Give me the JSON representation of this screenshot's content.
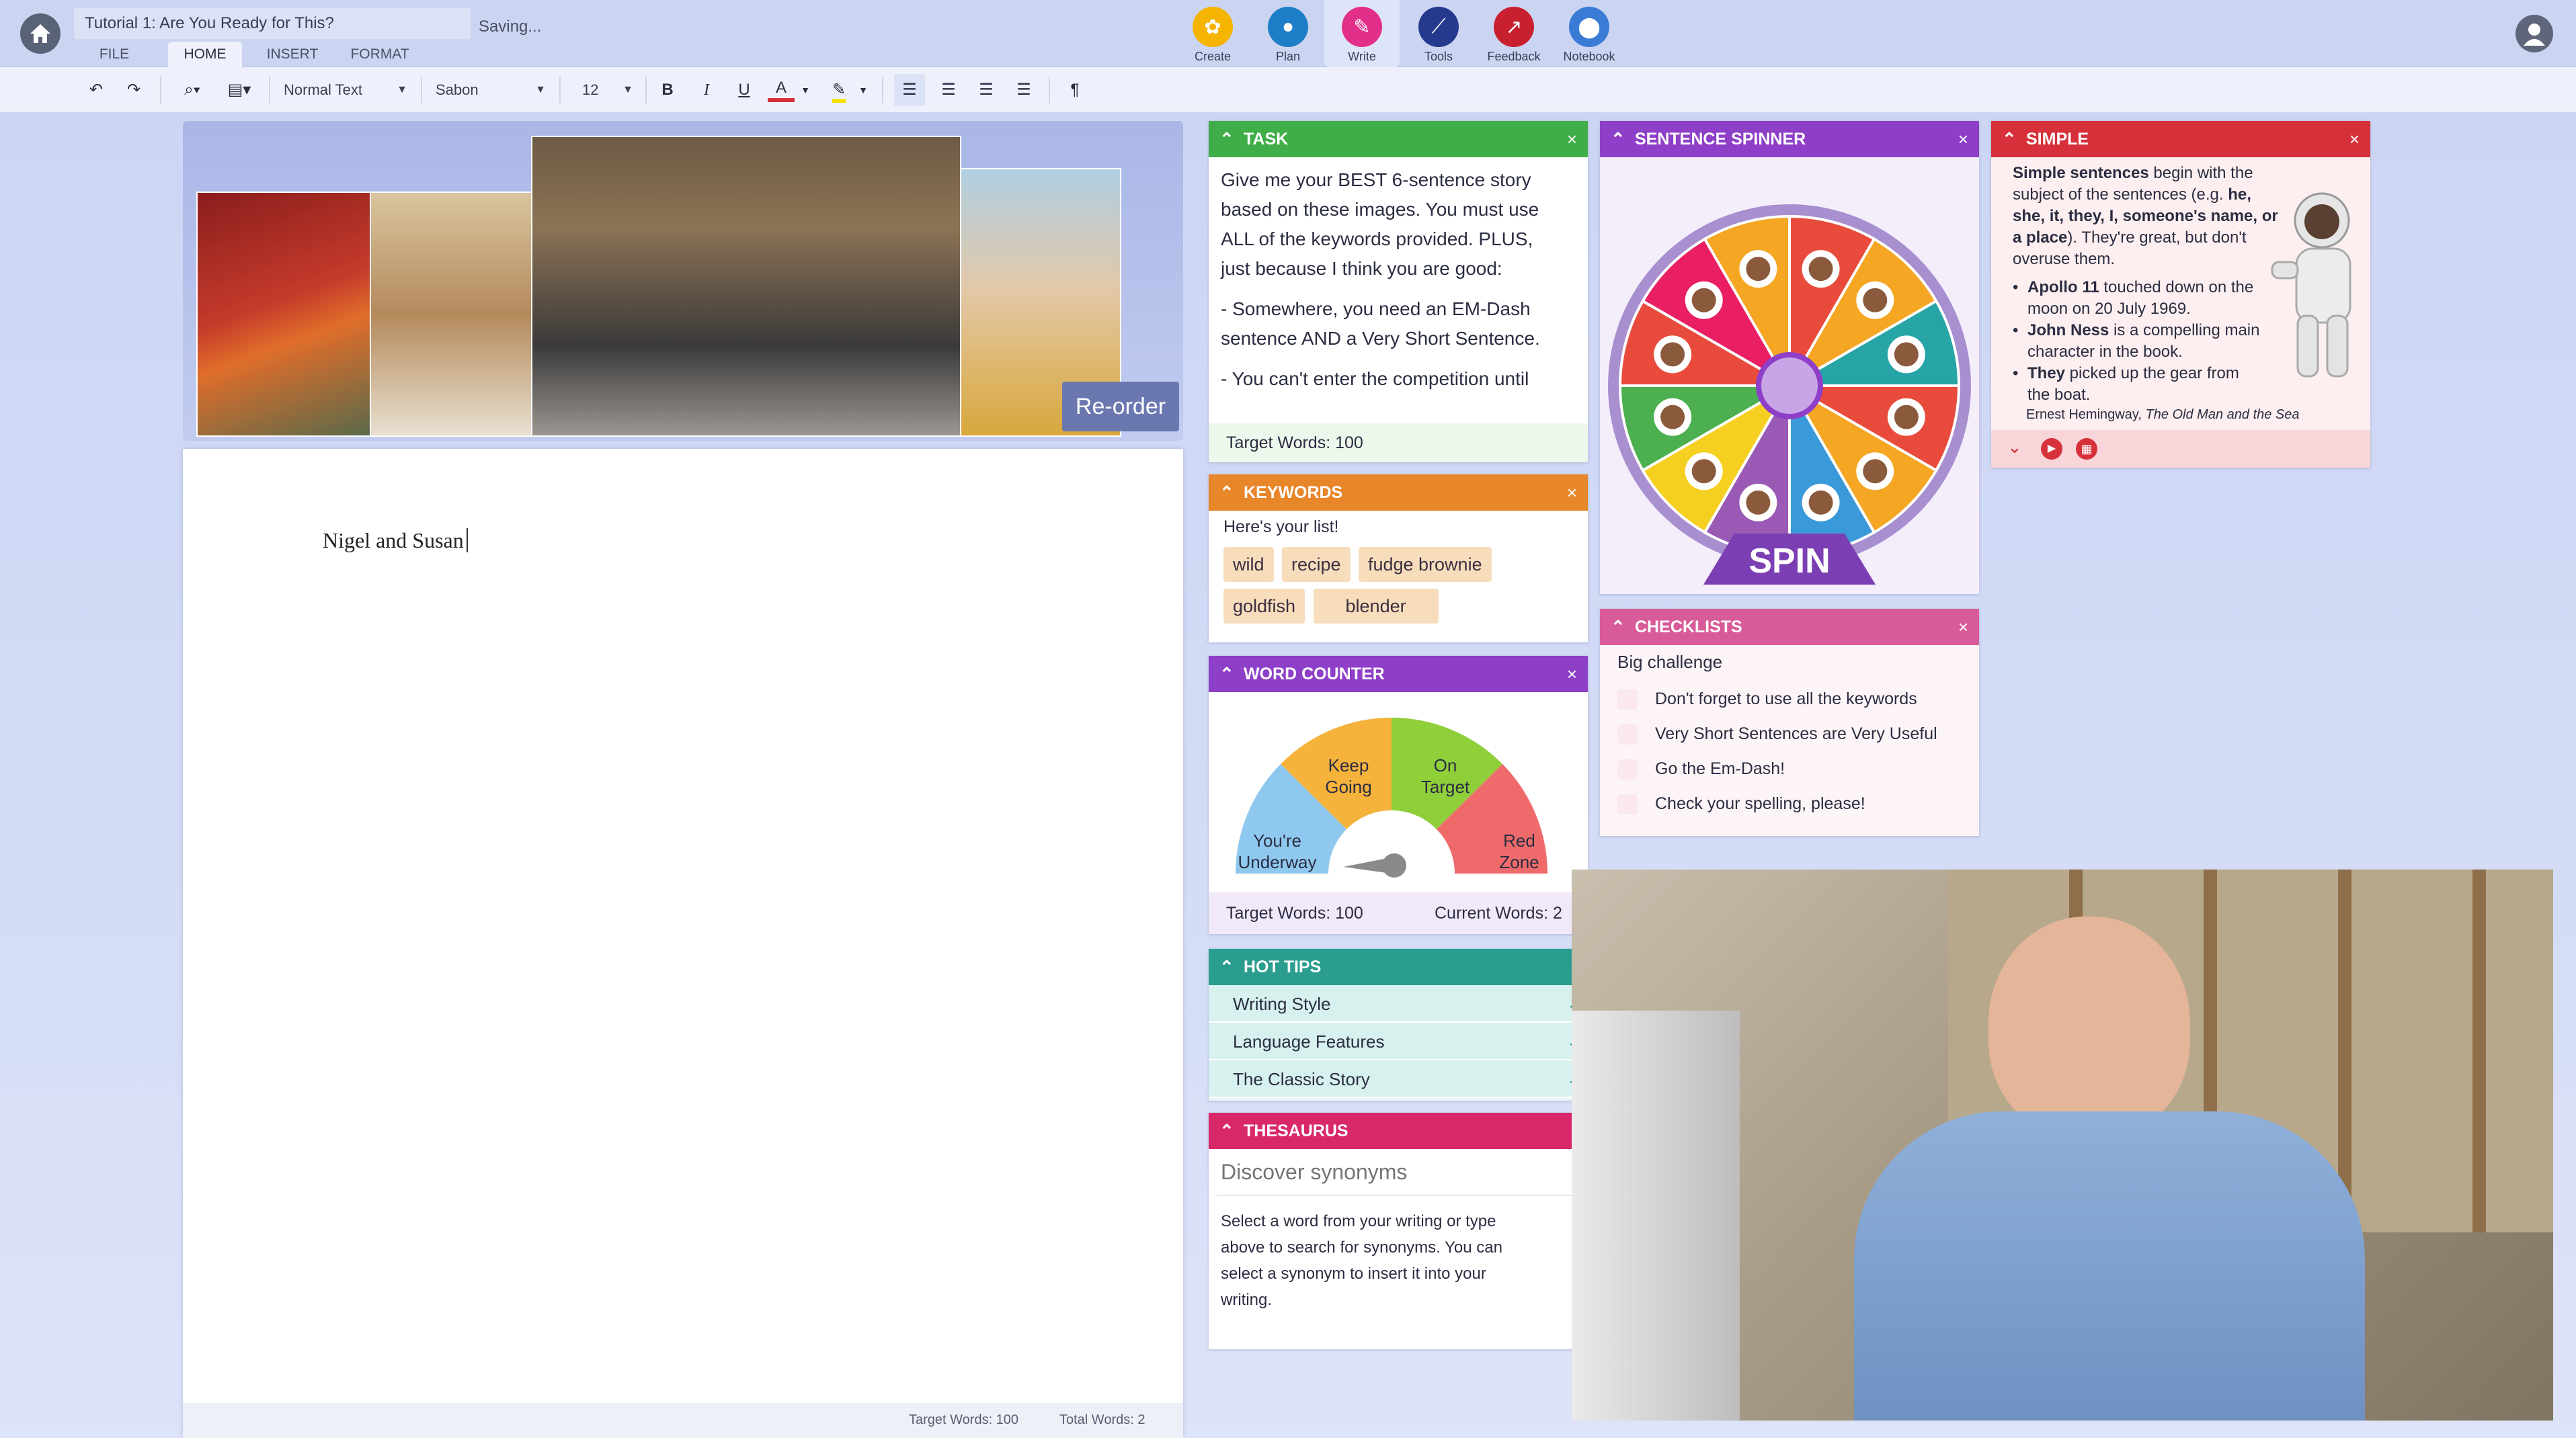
{
  "app": {
    "doc_title": "Tutorial 1: Are You Ready for This?",
    "saving": "Saving..."
  },
  "menu": [
    "FILE",
    "HOME",
    "INSERT",
    "FORMAT"
  ],
  "top_icons": [
    {
      "label": "Create",
      "icon": "create-icon",
      "color": "#f4b400"
    },
    {
      "label": "Plan",
      "icon": "plan-icon",
      "color": "#1d7dc6"
    },
    {
      "label": "Write",
      "icon": "write-icon",
      "color": "#e2308a"
    },
    {
      "label": "Tools",
      "icon": "tools-icon",
      "color": "#253a8f"
    },
    {
      "label": "Feedback",
      "icon": "feedback-icon",
      "color": "#c8202f"
    },
    {
      "label": "Notebook",
      "icon": "notebook-icon",
      "color": "#3a7bd5"
    }
  ],
  "toolbar": {
    "style": "Normal Text",
    "font": "Sabon",
    "size": "12",
    "bold": "B",
    "italic": "I",
    "underline": "U",
    "font_color": "A",
    "pilcrow": "¶"
  },
  "strip": {
    "reorder": "Re-order"
  },
  "document": {
    "text": "Nigel and Susan",
    "target": "Target Words: 100",
    "total": "Total Words: 2"
  },
  "task": {
    "title": "TASK",
    "lines": [
      "Give me your BEST 6-sentence story",
      "based on these images. You must use",
      "ALL of the keywords provided. PLUS,",
      "just because I think you are good:",
      "",
      "- Somewhere, you need an EM-Dash",
      "sentence AND a Very Short Sentence.",
      "",
      "- You can't enter the competition until"
    ],
    "footer": "Target Words: 100",
    "color": "#3fae49"
  },
  "keywords": {
    "title": "KEYWORDS",
    "intro": "Here's your list!",
    "chips": [
      "wild",
      "recipe",
      "fudge brownie",
      "goldfish",
      "blender"
    ],
    "color": "#e8862a"
  },
  "word_counter": {
    "title": "WORD COUNTER",
    "zones": [
      "You're Underway",
      "Keep Going",
      "On Target",
      "Red Zone"
    ],
    "target": "Target Words: 100",
    "current": "Current Words: 2",
    "color": "#8e3fc7"
  },
  "hot_tips": {
    "title": "HOT TIPS",
    "items": [
      "Writing Style",
      "Language Features",
      "The Classic Story"
    ],
    "color": "#2a9d8f"
  },
  "thesaurus": {
    "title": "THESAURUS",
    "placeholder": "Discover synonyms",
    "help": [
      "Select a word from your writing or type",
      "above to search for synonyms. You can",
      "select a synonym to insert it into your",
      "writing."
    ],
    "color": "#d8286a"
  },
  "spinner": {
    "title": "SENTENCE SPINNER",
    "spin": "SPIN",
    "color": "#8e3fc7",
    "segments": [
      "#e84b3c",
      "#f5a623",
      "#27a5a6",
      "#e84b3c",
      "#f5a623",
      "#3a9ad9",
      "#9b59b6",
      "#f5d020",
      "#4caf50",
      "#e84b3c",
      "#e91e63",
      "#f5a623"
    ]
  },
  "checklists": {
    "title": "CHECKLISTS",
    "heading": "Big challenge",
    "items": [
      "Don't forget to use all the keywords",
      "Very Short Sentences are Very Useful",
      "Go the Em-Dash!",
      "Check your spelling, please!"
    ],
    "color": "#d85a98"
  },
  "simple": {
    "title": "SIMPLE",
    "color": "#d6303a",
    "intro": [
      {
        "b": "Simple sentences"
      },
      {
        "t": " begin with the subject of the sentences (e.g. "
      },
      {
        "b": "he, she, it, they, I, someone's name, or a place"
      },
      {
        "t": "). They're great, but don't overuse them."
      }
    ],
    "bullets": [
      {
        "b": "Apollo 11",
        "t": " touched down on the moon on 20 July 1969."
      },
      {
        "b": "John Ness",
        "t": " is a compelling main character in the book."
      },
      {
        "b": "They",
        "t": " picked up the gear from the boat."
      }
    ],
    "credit": "Ernest Hemingway, ",
    "credit_book": "The Old Man and the Sea"
  }
}
